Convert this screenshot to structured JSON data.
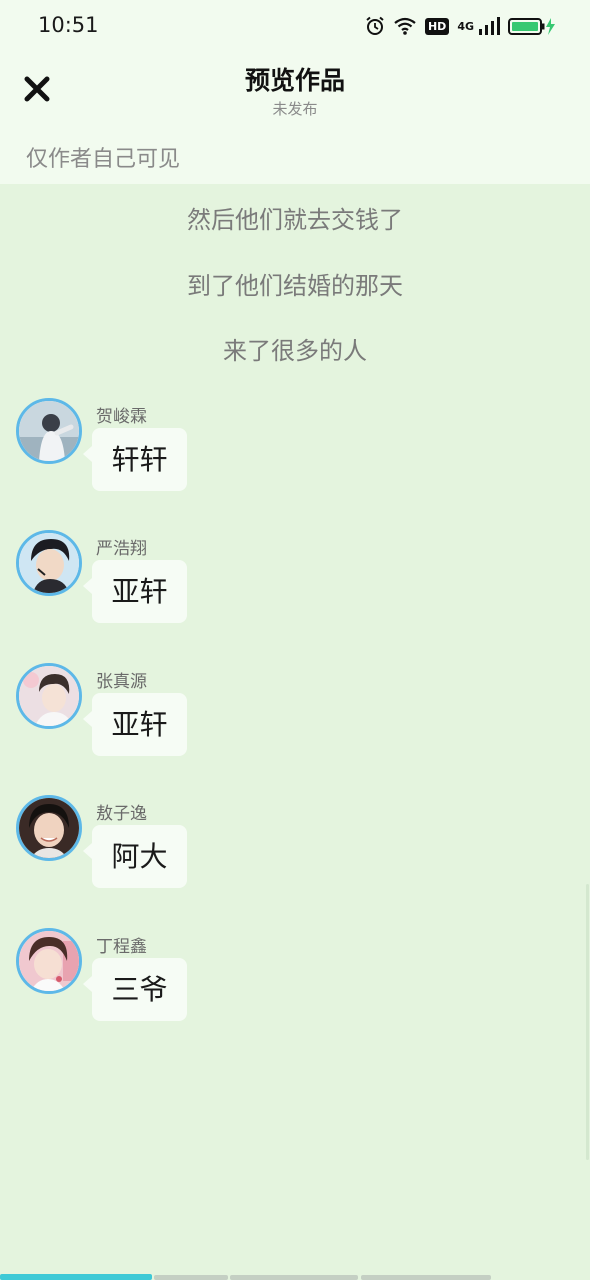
{
  "status": {
    "time": "10:51",
    "hd": "HD",
    "net": "4G"
  },
  "header": {
    "title": "预览作品",
    "subtitle": "未发布",
    "visibility": "仅作者自己可见"
  },
  "narration": [
    "然后他们就去交钱了",
    "到了他们结婚的那天",
    "来了很多的人"
  ],
  "messages": [
    {
      "speaker": "贺峻霖",
      "text": "轩轩"
    },
    {
      "speaker": "严浩翔",
      "text": "亚轩"
    },
    {
      "speaker": "张真源",
      "text": "亚轩"
    },
    {
      "speaker": "敖子逸",
      "text": "阿大"
    },
    {
      "speaker": "丁程鑫",
      "text": "三爷"
    }
  ],
  "colors": {
    "accent": "#5db8e8",
    "progress": "#3ec9d6",
    "background": "#e4f4de",
    "battery": "#37c871"
  }
}
